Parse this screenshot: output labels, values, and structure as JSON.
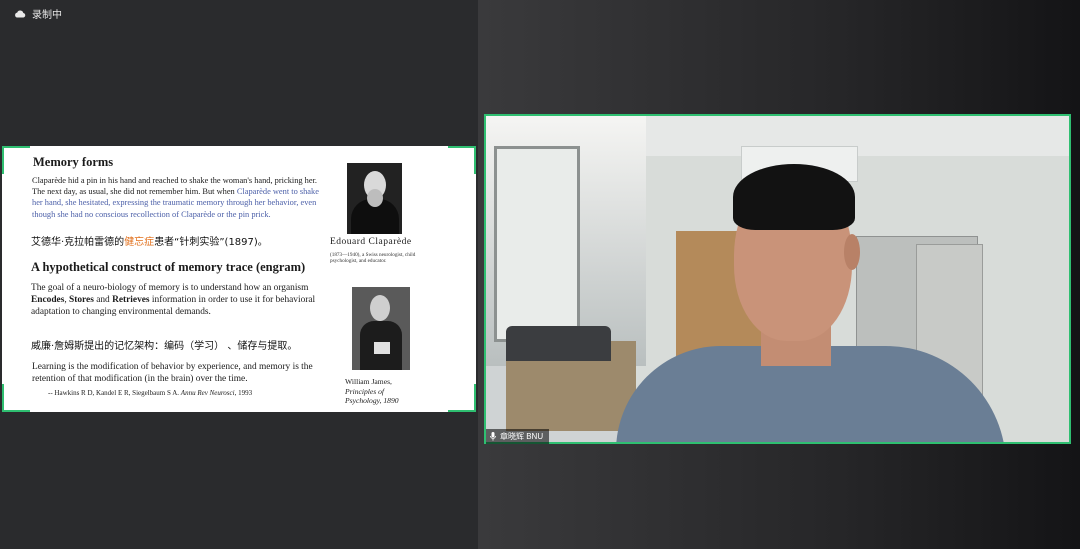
{
  "status": {
    "recording_label": "录制中"
  },
  "slide": {
    "heading1": "Memory forms",
    "para1_black": "Claparède hid a pin in his hand and reached to shake the woman's hand, pricking her. The next day, as usual, she did not remember him. But when",
    "para1_blue": "Claparède went to shake her hand, she hesitated, expressing the traumatic memory through her behavior, even though she had no conscious recollection of Claparède or the pin prick.",
    "chinese1_pre": "艾德华·克拉帕雷德的",
    "chinese1_highlight": "健忘症",
    "chinese1_post": "患者“针刺实验”(1897)。",
    "heading2": "A hypothetical construct of memory trace (engram)",
    "para2_a": "The goal of a neuro-biology of memory is to understand how an organism ",
    "para2_b1": "Encodes",
    "para2_c": ", ",
    "para2_b2": "Stores",
    "para2_d": " and ",
    "para2_b3": "Retrieves",
    "para2_e": " information in order to use it for behavioral adaptation to changing environmental demands.",
    "chinese2": "威廉·詹姆斯提出的记忆架构：编码（学习） 、储存与提取。",
    "para3": "Learning is the modification of behavior by experience, and memory is the retention of that modification (in the brain) over the time.",
    "citation_pre": "-- Hawkins R D, Kandel E R, Siegelbaum S A. ",
    "citation_journal": "Annu Rev Neurosci",
    "citation_post": ", 1993",
    "claparede_name": "Edouard Claparède",
    "claparede_caption": "(1873—1940), a Swiss neurologist, child psychologist, and educator.",
    "james_name": "William James,",
    "james_book1": "Principles of",
    "james_book2": "Psychology, 1890"
  },
  "video": {
    "participant_name": "章晓辉 BNU",
    "border_color": "#2fbf71"
  },
  "icons": {
    "recording": "cloud-icon",
    "mic": "microphone-icon"
  }
}
